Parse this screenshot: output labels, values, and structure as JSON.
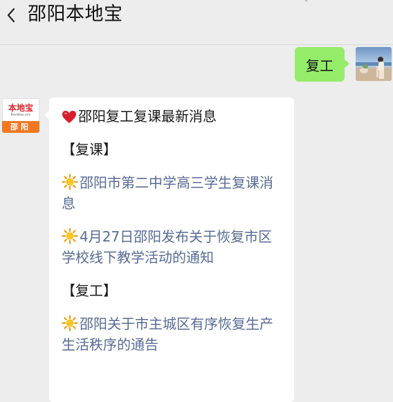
{
  "header": {
    "title": "邵阳本地宝",
    "back_icon": "chevron-left-icon"
  },
  "my_message": {
    "text": "复工"
  },
  "account": {
    "logo_text": "本地宝",
    "logo_domain": "Bendibao.com",
    "logo_city": "邵阳"
  },
  "account_message": {
    "heading": "邵阳复工复课最新消息",
    "heading_icon": "heart-icon",
    "sections": [
      {
        "label": "【复课】"
      },
      {
        "label": "【复工】"
      }
    ],
    "links": [
      {
        "icon": "sun-icon",
        "text": "邵阳市第二中学高三学生复课消息"
      },
      {
        "icon": "sun-icon",
        "text": "4月27日邵阳发布关于恢复市区学校线下教学活动的通知"
      },
      {
        "icon": "sun-icon",
        "text": "邵阳关于市主城区有序恢复生产生活秩序的通告"
      }
    ]
  },
  "colors": {
    "background": "#ededed",
    "my_bubble": "#95ec69",
    "link": "#576b95",
    "logo_red": "#d8232a",
    "logo_orange": "#f17720",
    "heart": "#d61e2e",
    "sun": "#f39a12"
  }
}
